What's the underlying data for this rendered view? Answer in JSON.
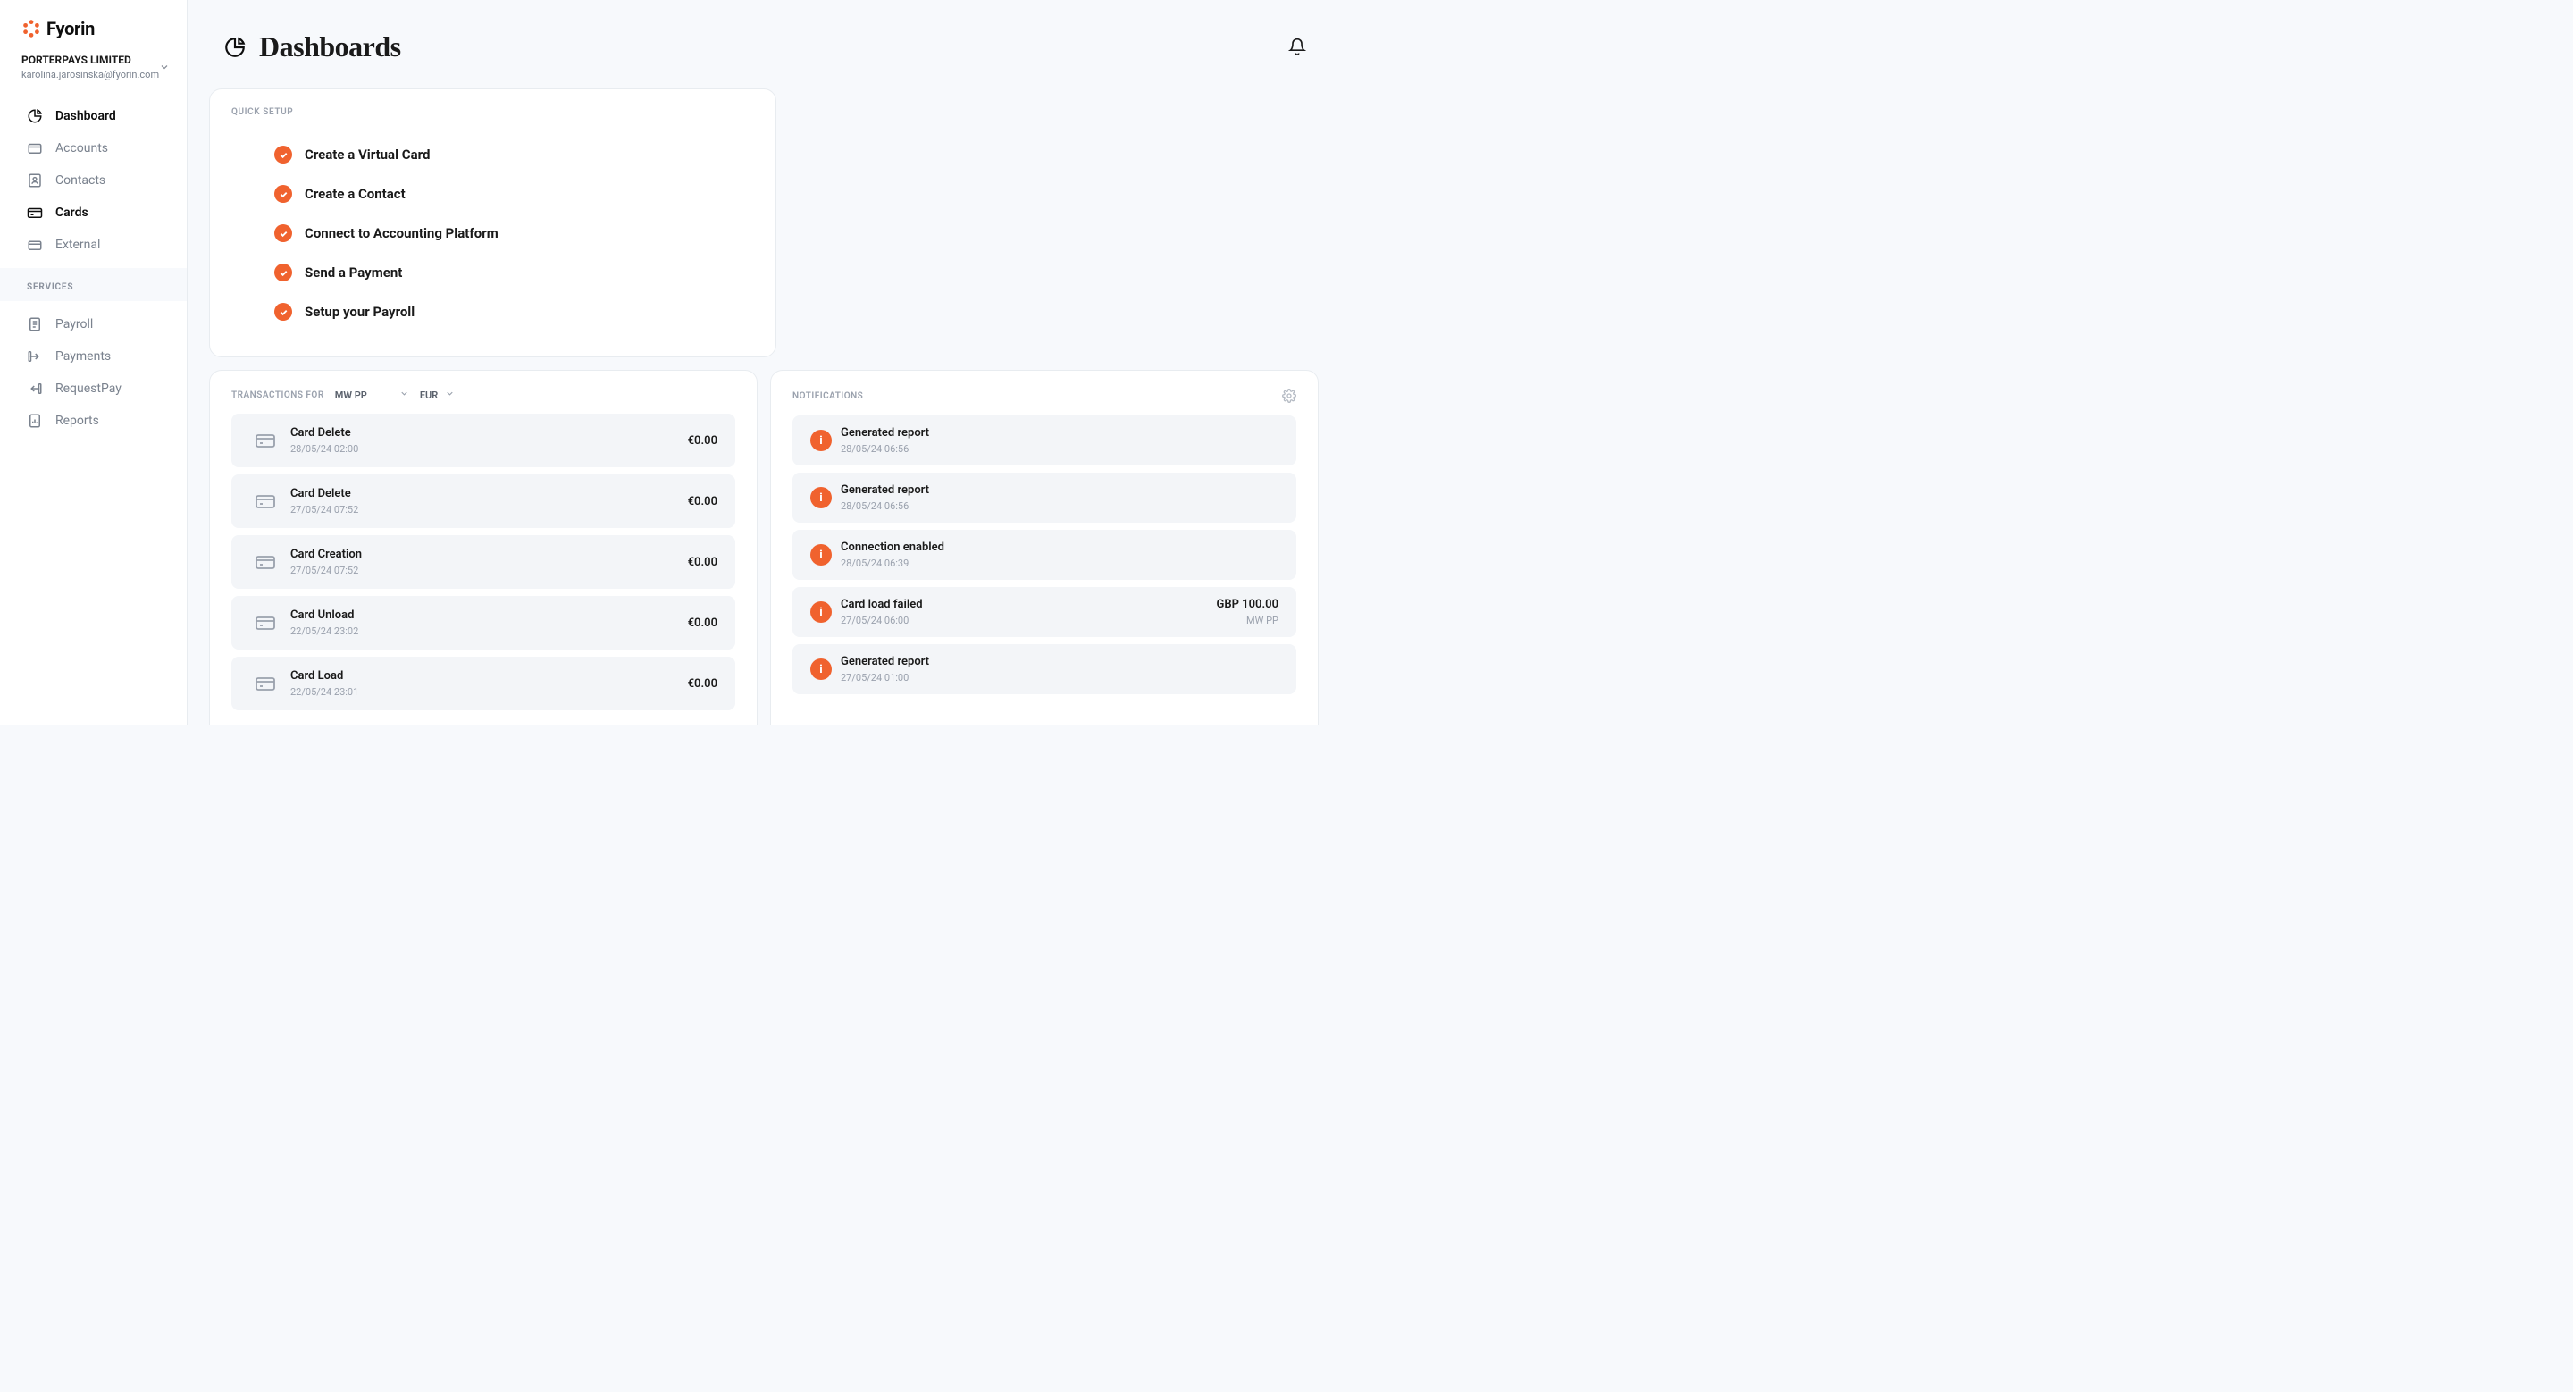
{
  "brand": "Fyorin",
  "org": {
    "name": "PORTERPAYS LIMITED",
    "email": "karolina.jarosinska@fyorin.com"
  },
  "nav": {
    "main": [
      {
        "label": "Dashboard",
        "active": true
      },
      {
        "label": "Accounts",
        "active": false
      },
      {
        "label": "Contacts",
        "active": false
      },
      {
        "label": "Cards",
        "active": true
      },
      {
        "label": "External",
        "active": false
      }
    ],
    "section_label": "SERVICES",
    "services": [
      {
        "label": "Payroll"
      },
      {
        "label": "Payments"
      },
      {
        "label": "RequestPay"
      },
      {
        "label": "Reports"
      }
    ]
  },
  "page_title": "Dashboards",
  "quick_setup": {
    "label": "QUICK SETUP",
    "items": [
      "Create a Virtual Card",
      "Create a Contact",
      "Connect to Accounting Platform",
      "Send a Payment",
      "Setup your Payroll"
    ]
  },
  "transactions": {
    "label": "TRANSACTIONS FOR",
    "account": "MW PP",
    "currency": "EUR",
    "items": [
      {
        "title": "Card Delete",
        "date": "28/05/24 02:00",
        "amount": "€0.00"
      },
      {
        "title": "Card Delete",
        "date": "27/05/24 07:52",
        "amount": "€0.00"
      },
      {
        "title": "Card Creation",
        "date": "27/05/24 07:52",
        "amount": "€0.00"
      },
      {
        "title": "Card Unload",
        "date": "22/05/24 23:02",
        "amount": "€0.00"
      },
      {
        "title": "Card Load",
        "date": "22/05/24 23:01",
        "amount": "€0.00"
      }
    ]
  },
  "notifications": {
    "label": "NOTIFICATIONS",
    "items": [
      {
        "title": "Generated report",
        "date": "28/05/24 06:56",
        "amount": "",
        "sub": ""
      },
      {
        "title": "Generated report",
        "date": "28/05/24 06:56",
        "amount": "",
        "sub": ""
      },
      {
        "title": "Connection enabled",
        "date": "28/05/24 06:39",
        "amount": "",
        "sub": ""
      },
      {
        "title": "Card load failed",
        "date": "27/05/24 06:00",
        "amount": "GBP 100.00",
        "sub": "MW PP"
      },
      {
        "title": "Generated report",
        "date": "27/05/24 01:00",
        "amount": "",
        "sub": ""
      }
    ]
  }
}
